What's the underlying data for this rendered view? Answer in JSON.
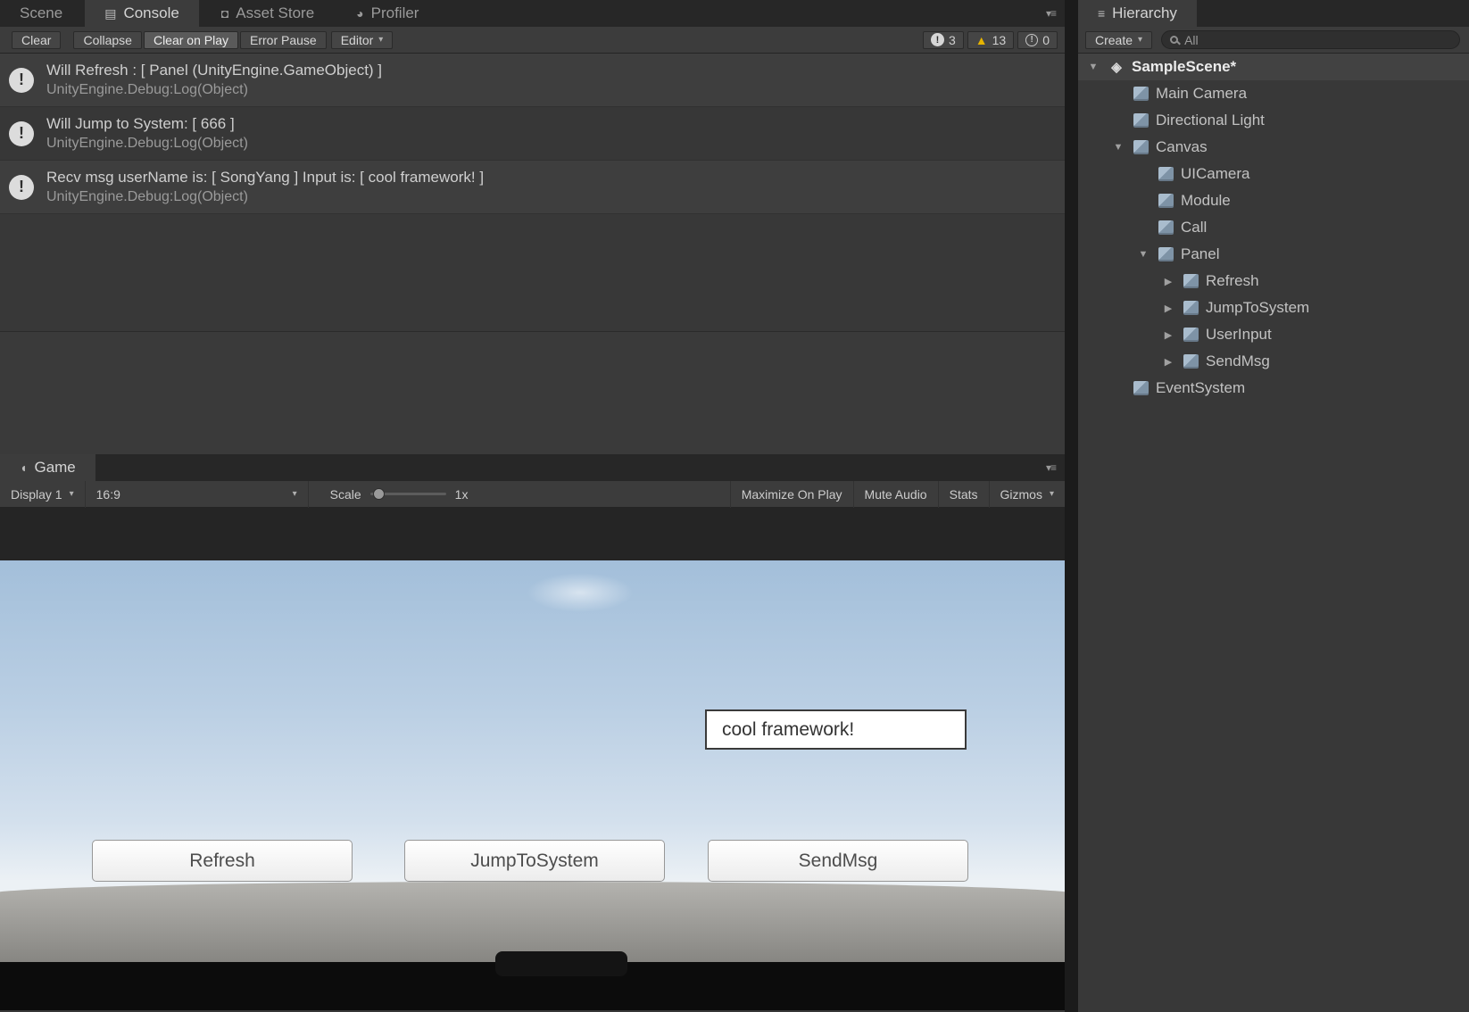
{
  "icons": {
    "panel_menu": "▾≡",
    "dropdown": "▾",
    "warning": "▲",
    "exclaim": "!",
    "tree_expanded": "▼",
    "tree_collapsed": "▶",
    "console_tab": "▤",
    "asset_store": "◘",
    "profiler": "◕",
    "game_tab": "◖",
    "hierarchy_tab": "≡",
    "unity_logo": "◈"
  },
  "colors": {
    "warning_yellow": "#e6b400",
    "panel_dark": "#3c3c3c",
    "tabbar_dark": "#272727"
  },
  "top_tabs": {
    "scene": "Scene",
    "console": "Console",
    "asset_store": "Asset Store",
    "profiler": "Profiler"
  },
  "console": {
    "toolbar": {
      "clear": "Clear",
      "collapse": "Collapse",
      "clear_on_play": "Clear on Play",
      "error_pause": "Error Pause",
      "editor": "Editor",
      "info_count": "3",
      "warning_count": "13",
      "error_count": "0"
    },
    "logs": [
      {
        "message": "Will Refresh : [ Panel (UnityEngine.GameObject) ]",
        "source": "UnityEngine.Debug:Log(Object)"
      },
      {
        "message": "Will Jump to System: [ 666 ]",
        "source": "UnityEngine.Debug:Log(Object)"
      },
      {
        "message": "Recv msg userName is: [ SongYang ] Input is: [ cool framework! ]",
        "source": "UnityEngine.Debug:Log(Object)"
      }
    ]
  },
  "game": {
    "tab": "Game",
    "toolbar": {
      "display": "Display 1",
      "aspect": "16:9",
      "scale_label": "Scale",
      "scale_value": "1x",
      "maximize_on_play": "Maximize On Play",
      "mute_audio": "Mute Audio",
      "stats": "Stats",
      "gizmos": "Gizmos"
    },
    "input_value": "cool framework!",
    "buttons": [
      "Refresh",
      "JumpToSystem",
      "SendMsg"
    ]
  },
  "hierarchy": {
    "tab_label": "Hierarchy",
    "create_label": "Create",
    "search_value": "All",
    "items": [
      {
        "label": "SampleScene*",
        "indent": 0,
        "arrow": "expanded",
        "icon": "unity",
        "style": "scene"
      },
      {
        "label": "Main Camera",
        "indent": 1,
        "arrow": "none",
        "icon": "cube"
      },
      {
        "label": "Directional Light",
        "indent": 1,
        "arrow": "none",
        "icon": "cube"
      },
      {
        "label": "Canvas",
        "indent": 1,
        "arrow": "expanded",
        "icon": "cube"
      },
      {
        "label": "UICamera",
        "indent": 2,
        "arrow": "none",
        "icon": "cube"
      },
      {
        "label": "Module",
        "indent": 2,
        "arrow": "none",
        "icon": "cube"
      },
      {
        "label": "Call",
        "indent": 2,
        "arrow": "none",
        "icon": "cube"
      },
      {
        "label": "Panel",
        "indent": 2,
        "arrow": "expanded",
        "icon": "cube"
      },
      {
        "label": "Refresh",
        "indent": 3,
        "arrow": "collapsed",
        "icon": "cube"
      },
      {
        "label": "JumpToSystem",
        "indent": 3,
        "arrow": "collapsed",
        "icon": "cube"
      },
      {
        "label": "UserInput",
        "indent": 3,
        "arrow": "collapsed",
        "icon": "cube"
      },
      {
        "label": "SendMsg",
        "indent": 3,
        "arrow": "collapsed",
        "icon": "cube"
      },
      {
        "label": "EventSystem",
        "indent": 1,
        "arrow": "none",
        "icon": "cube"
      }
    ]
  }
}
